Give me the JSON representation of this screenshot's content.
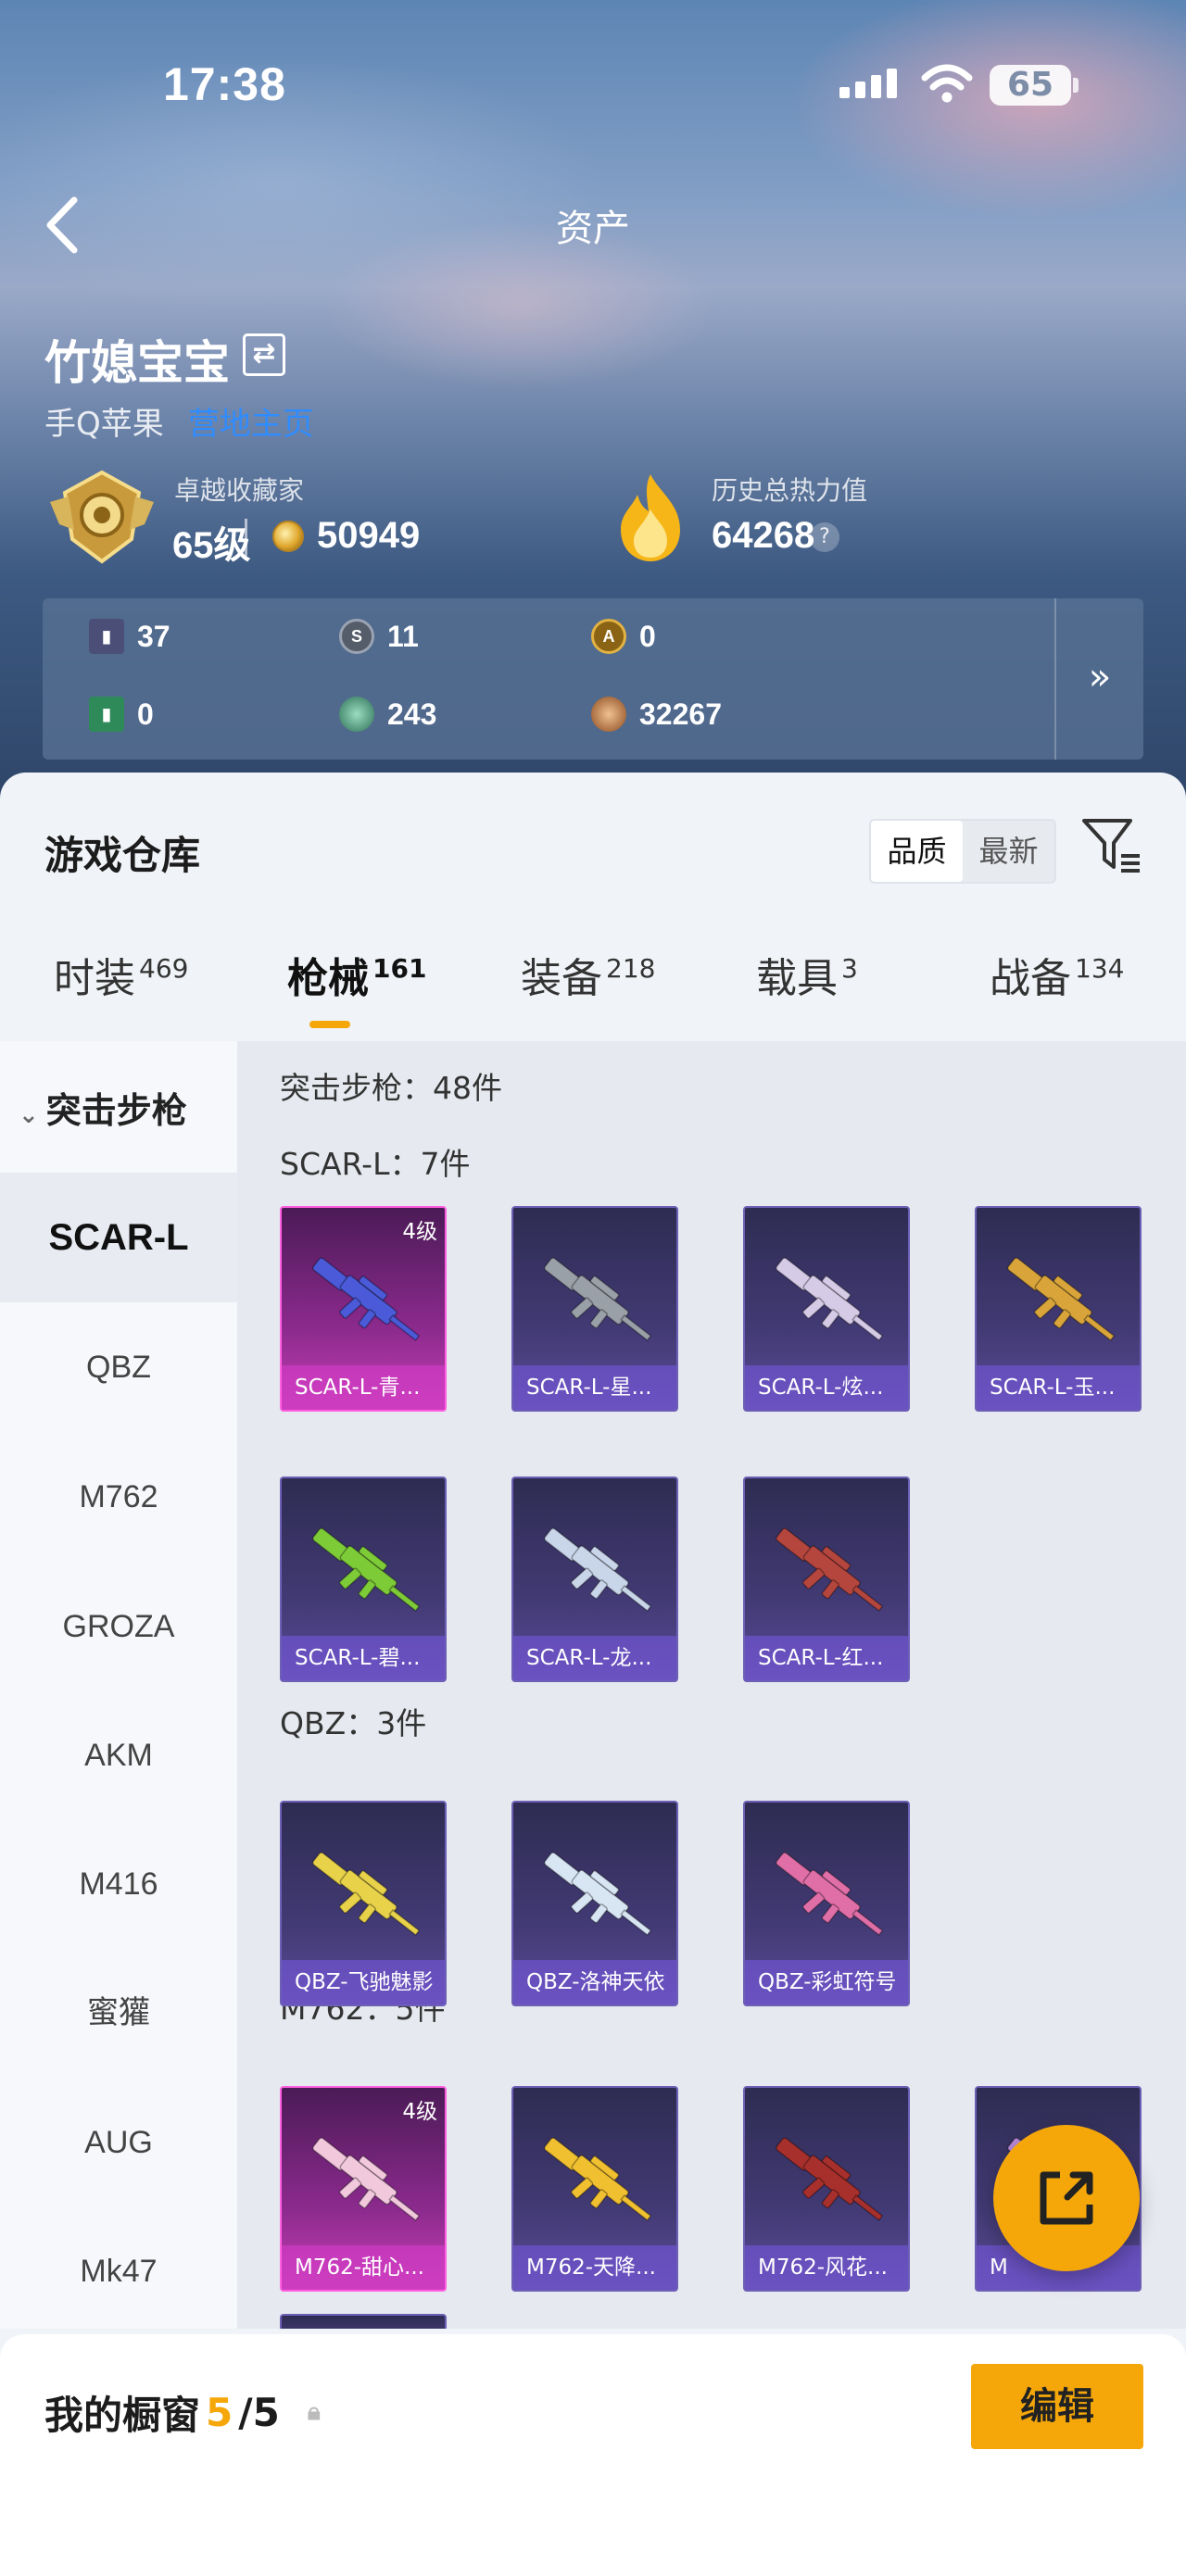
{
  "status_bar": {
    "time": "17:38",
    "battery": "65"
  },
  "header": {
    "title": "资产"
  },
  "profile": {
    "name": "竹媳宝宝",
    "platform": "手Q苹果",
    "platform_link": "营地主页",
    "collector_label": "卓越收藏家",
    "level": "65级",
    "coins": "50949",
    "heat_label": "历史总热力值",
    "heat_value": "64268",
    "help": "?"
  },
  "stats": {
    "row1": [
      {
        "icon": "card-icon",
        "value": "37"
      },
      {
        "icon": "s-token-icon",
        "value": "11"
      },
      {
        "icon": "a-token-icon",
        "value": "0"
      }
    ],
    "row2": [
      {
        "icon": "green-card-icon",
        "value": "0"
      },
      {
        "icon": "gem-icon",
        "value": "243"
      },
      {
        "icon": "bronze-coin-icon",
        "value": "32267"
      }
    ],
    "more": "»"
  },
  "warehouse": {
    "title": "游戏仓库",
    "sort_options": [
      "品质",
      "最新"
    ],
    "selected_sort": "品质"
  },
  "tabs": [
    {
      "label": "时装",
      "count": "469"
    },
    {
      "label": "枪械",
      "count": "161"
    },
    {
      "label": "装备",
      "count": "218"
    },
    {
      "label": "载具",
      "count": "3"
    },
    {
      "label": "战备",
      "count": "134"
    }
  ],
  "active_tab": "枪械",
  "sidebar": {
    "category": "突击步枪",
    "items": [
      "SCAR-L",
      "QBZ",
      "M762",
      "GROZA",
      "AKM",
      "M416",
      "蜜獾",
      "AUG",
      "Mk47"
    ],
    "selected": "SCAR-L"
  },
  "grid": {
    "category_header": "突击步枪：48件",
    "groups": [
      {
        "header": "SCAR-L：7件",
        "items": [
          {
            "name": "SCAR-L-青...",
            "level": "4级",
            "rarity": "pink",
            "color": "#4a5ad8"
          },
          {
            "name": "SCAR-L-星...",
            "level": "",
            "rarity": "purple",
            "color": "#9aa0a8"
          },
          {
            "name": "SCAR-L-炫...",
            "level": "",
            "rarity": "purple",
            "color": "#d6cbe6"
          },
          {
            "name": "SCAR-L-玉...",
            "level": "",
            "rarity": "purple",
            "color": "#d9a53a"
          },
          {
            "name": "SCAR-L-碧...",
            "level": "",
            "rarity": "purple",
            "color": "#7ecb38"
          },
          {
            "name": "SCAR-L-龙...",
            "level": "",
            "rarity": "purple",
            "color": "#c9d6ea"
          },
          {
            "name": "SCAR-L-红...",
            "level": "",
            "rarity": "purple",
            "color": "#b5463e"
          }
        ]
      },
      {
        "header": "QBZ：3件",
        "items": [
          {
            "name": "QBZ-飞驰魅影",
            "level": "",
            "rarity": "purple",
            "color": "#e8d24a"
          },
          {
            "name": "QBZ-洛神天依",
            "level": "",
            "rarity": "purple",
            "color": "#d8e6f4"
          },
          {
            "name": "QBZ-彩虹符号",
            "level": "",
            "rarity": "purple",
            "color": "#e06fa8"
          }
        ]
      },
      {
        "header": "M762：5件",
        "items": [
          {
            "name": "M762-甜心...",
            "level": "4级",
            "rarity": "pink",
            "color": "#f2c8dc"
          },
          {
            "name": "M762-天降...",
            "level": "",
            "rarity": "purple",
            "color": "#f0c030"
          },
          {
            "name": "M762-风花...",
            "level": "",
            "rarity": "purple",
            "color": "#a8302c"
          },
          {
            "name": "M",
            "level": "",
            "rarity": "purple",
            "color": "#b88ad8"
          }
        ]
      }
    ]
  },
  "showcase": {
    "label": "我的橱窗",
    "current": "5",
    "total": "/5",
    "edit": "编辑"
  },
  "colors": {
    "accent": "#f5a70a",
    "link": "#2f8cff",
    "pink_rarity": "#ff5fe0",
    "purple_rarity": "#6e5fb6"
  }
}
